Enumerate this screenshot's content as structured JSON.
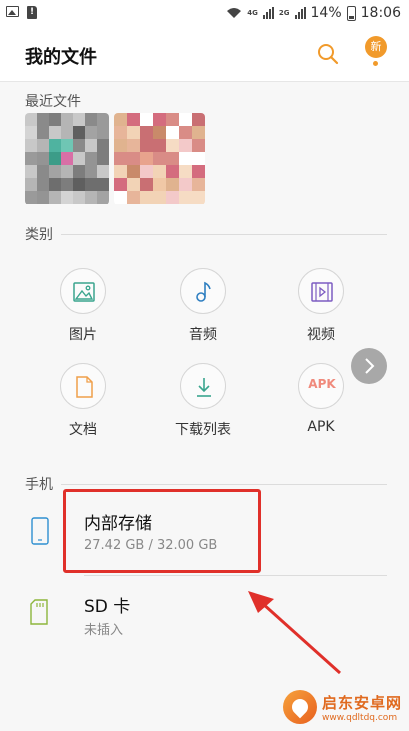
{
  "status_bar": {
    "battery": "14%",
    "time": "18:06",
    "net_label_1": "4G",
    "net_label_2": "2G"
  },
  "header": {
    "title": "我的文件",
    "new_badge": "新"
  },
  "recent": {
    "label": "最近文件"
  },
  "categories": {
    "label": "类别",
    "items": [
      {
        "label": "图片",
        "icon": "image-icon"
      },
      {
        "label": "音频",
        "icon": "music-note-icon"
      },
      {
        "label": "视频",
        "icon": "video-icon"
      },
      {
        "label": "文档",
        "icon": "document-icon"
      },
      {
        "label": "下载列表",
        "icon": "download-icon"
      },
      {
        "label": "APK",
        "icon": "apk-icon",
        "glyph": "APK"
      }
    ]
  },
  "phone": {
    "label": "手机",
    "storage": [
      {
        "name": "内部存储",
        "detail": "27.42 GB / 32.00 GB",
        "icon": "phone-storage-icon"
      },
      {
        "name": "SD 卡",
        "detail": "未插入",
        "icon": "sd-card-icon"
      }
    ]
  },
  "watermark": {
    "title": "启东安卓网",
    "url": "www.qdltdq.com"
  },
  "colors": {
    "accent": "#f19a2b",
    "annotation": "#e0302a",
    "category_icon": "#3aa58e"
  }
}
